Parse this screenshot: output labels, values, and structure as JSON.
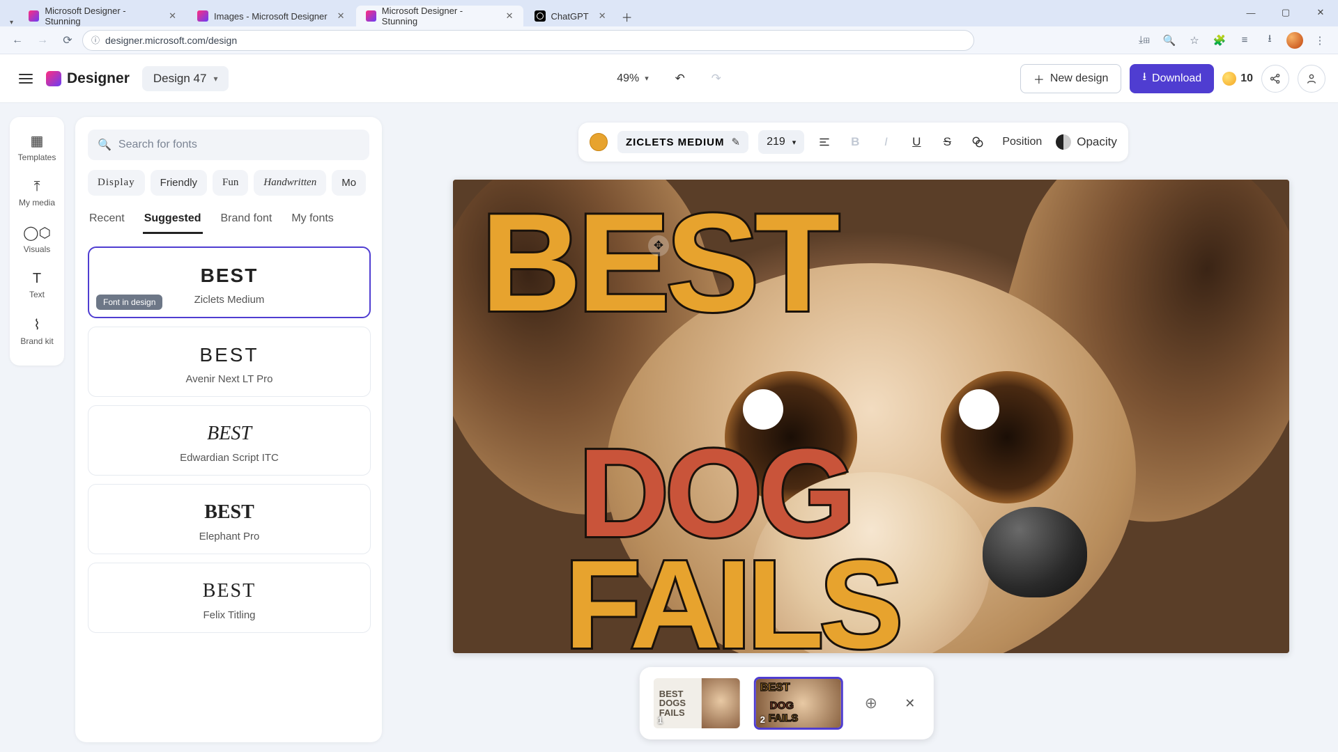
{
  "browser": {
    "tabs": [
      {
        "title": "Microsoft Designer - Stunning",
        "active": false,
        "favicon": "designer"
      },
      {
        "title": "Images - Microsoft Designer",
        "active": false,
        "favicon": "designer"
      },
      {
        "title": "Microsoft Designer - Stunning",
        "active": true,
        "favicon": "designer"
      },
      {
        "title": "ChatGPT",
        "active": false,
        "favicon": "chatgpt"
      }
    ],
    "url": "designer.microsoft.com/design"
  },
  "header": {
    "app_name": "Designer",
    "design_name": "Design 47",
    "zoom": "49%",
    "new_design_label": "New design",
    "download_label": "Download",
    "credits": "10"
  },
  "rail": {
    "items": [
      {
        "label": "Templates",
        "icon": "templates"
      },
      {
        "label": "My media",
        "icon": "upload"
      },
      {
        "label": "Visuals",
        "icon": "visuals"
      },
      {
        "label": "Text",
        "icon": "text"
      },
      {
        "label": "Brand kit",
        "icon": "brand"
      }
    ]
  },
  "font_panel": {
    "search_placeholder": "Search for fonts",
    "categories": [
      "Display",
      "Friendly",
      "Fun",
      "Handwritten",
      "Mo"
    ],
    "tabs": [
      "Recent",
      "Suggested",
      "Brand font",
      "My fonts"
    ],
    "active_tab": "Suggested",
    "badge": "Font in design",
    "sample_word": "BEST",
    "fonts": [
      {
        "name": "Ziclets Medium",
        "selected": true,
        "style": "chunky"
      },
      {
        "name": "Avenir Next LT Pro",
        "style": "sans-light"
      },
      {
        "name": "Edwardian Script ITC",
        "style": "script"
      },
      {
        "name": "Elephant Pro",
        "style": "serif-heavy"
      },
      {
        "name": "Felix Titling",
        "style": "serif-caps"
      }
    ]
  },
  "text_toolbar": {
    "color": "#e7a32e",
    "font_name": "Ziclets Medium",
    "font_size": "219",
    "position_label": "Position",
    "opacity_label": "Opacity"
  },
  "canvas": {
    "words": [
      "BEST",
      "DOG",
      "FAILS"
    ]
  },
  "pages": {
    "items": [
      {
        "number": "1",
        "selected": false,
        "label_lines": [
          "BEST",
          "DOGS",
          "FAILS"
        ]
      },
      {
        "number": "2",
        "selected": true
      }
    ]
  }
}
